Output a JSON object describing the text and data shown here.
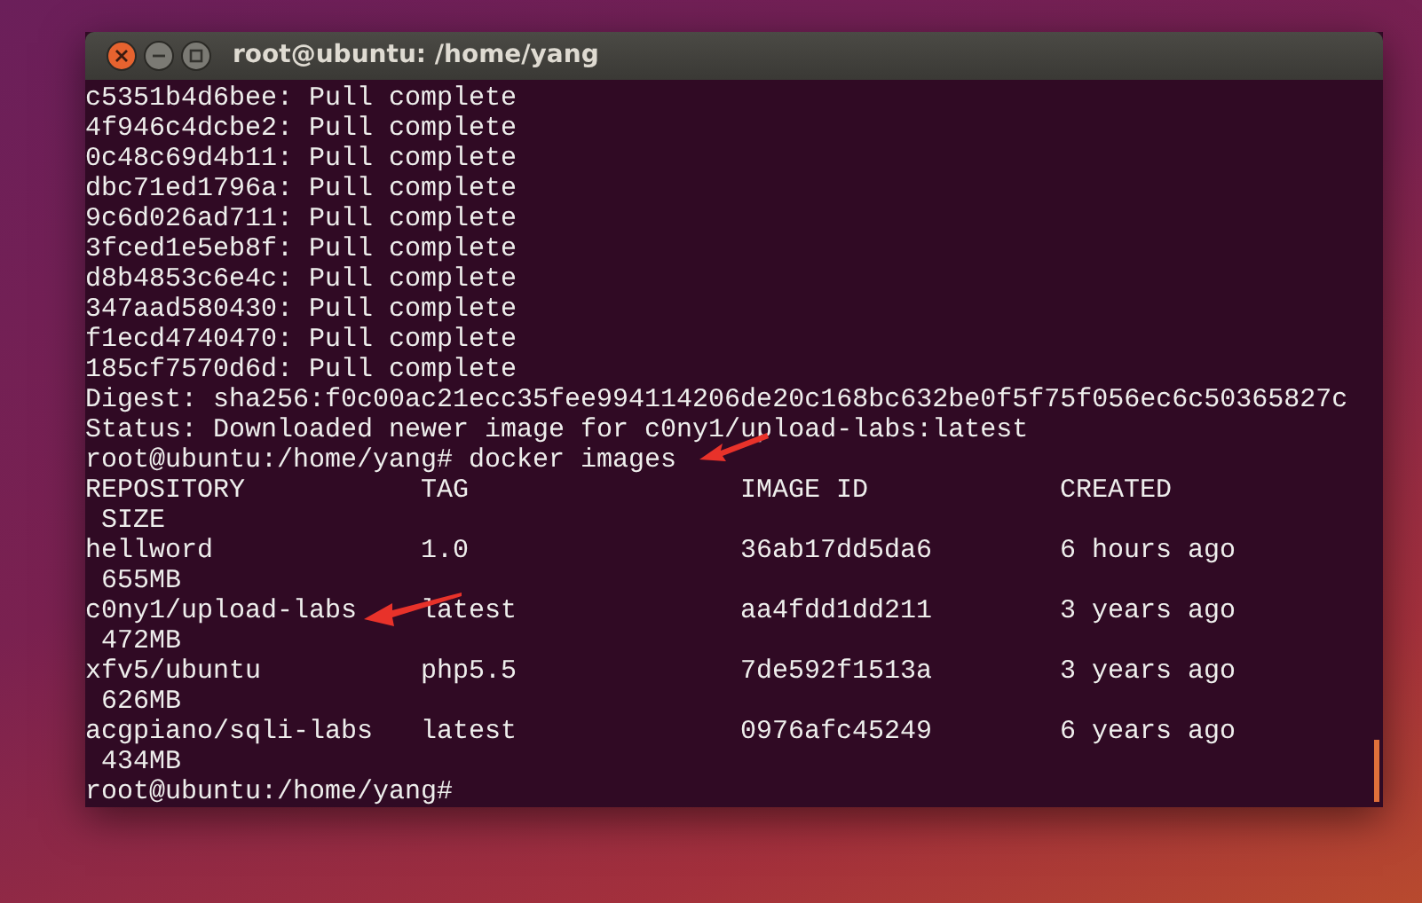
{
  "window": {
    "title": "root@ubuntu: /home/yang"
  },
  "output": [
    "c5351b4d6bee: Pull complete",
    "4f946c4dcbe2: Pull complete",
    "0c48c69d4b11: Pull complete",
    "dbc71ed1796a: Pull complete",
    "9c6d026ad711: Pull complete",
    "3fced1e5eb8f: Pull complete",
    "d8b4853c6e4c: Pull complete",
    "347aad580430: Pull complete",
    "f1ecd4740470: Pull complete",
    "185cf7570d6d: Pull complete",
    "Digest: sha256:f0c00ac21ecc35fee994114206de20c168bc632be0f5f75f056ec6c50365827c",
    "Status: Downloaded newer image for c0ny1/upload-labs:latest"
  ],
  "command_line": "root@ubuntu:/home/yang# docker images",
  "table": {
    "columns": [
      "REPOSITORY",
      "TAG",
      "IMAGE ID",
      "CREATED",
      "SIZE"
    ],
    "rows": [
      {
        "repository": "hellword",
        "tag": "1.0",
        "image_id": "36ab17dd5da6",
        "created": "6 hours ago",
        "size": "655MB"
      },
      {
        "repository": "c0ny1/upload-labs",
        "tag": "latest",
        "image_id": "aa4fdd1dd211",
        "created": "3 years ago",
        "size": "472MB"
      },
      {
        "repository": "xfv5/ubuntu",
        "tag": "php5.5",
        "image_id": "7de592f1513a",
        "created": "3 years ago",
        "size": "626MB"
      },
      {
        "repository": "acgpiano/sqli-labs",
        "tag": "latest",
        "image_id": "0976afc45249",
        "created": "6 years ago",
        "size": "434MB"
      }
    ]
  },
  "final_prompt": "root@ubuntu:/home/yang#"
}
